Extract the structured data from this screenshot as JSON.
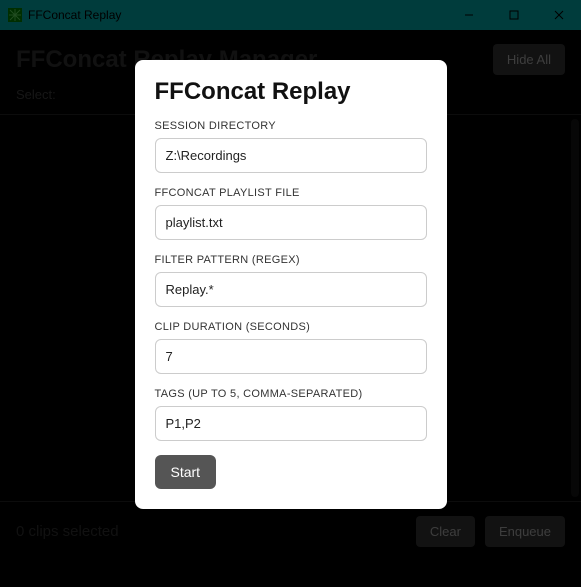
{
  "window": {
    "title": "FFConcat Replay",
    "minimize_label": "Minimize",
    "maximize_label": "Maximize",
    "close_label": "Close"
  },
  "header": {
    "title": "FFConcat Replay Manager",
    "hide_all_label": "Hide All"
  },
  "select_row": {
    "label": "Select:"
  },
  "footer": {
    "status": "0 clips selected",
    "clear_label": "Clear",
    "enqueue_label": "Enqueue"
  },
  "modal": {
    "title": "FFConcat Replay",
    "fields": {
      "session_dir": {
        "label": "SESSION DIRECTORY",
        "value": "Z:\\Recordings"
      },
      "playlist": {
        "label": "FFCONCAT PLAYLIST FILE",
        "value": "playlist.txt"
      },
      "filter": {
        "label": "FILTER PATTERN (REGEX)",
        "value": "Replay.*"
      },
      "duration": {
        "label": "CLIP DURATION (SECONDS)",
        "value": "7"
      },
      "tags": {
        "label": "TAGS (UP TO 5, COMMA-SEPARATED)",
        "value": "P1,P2"
      }
    },
    "start_label": "Start"
  }
}
